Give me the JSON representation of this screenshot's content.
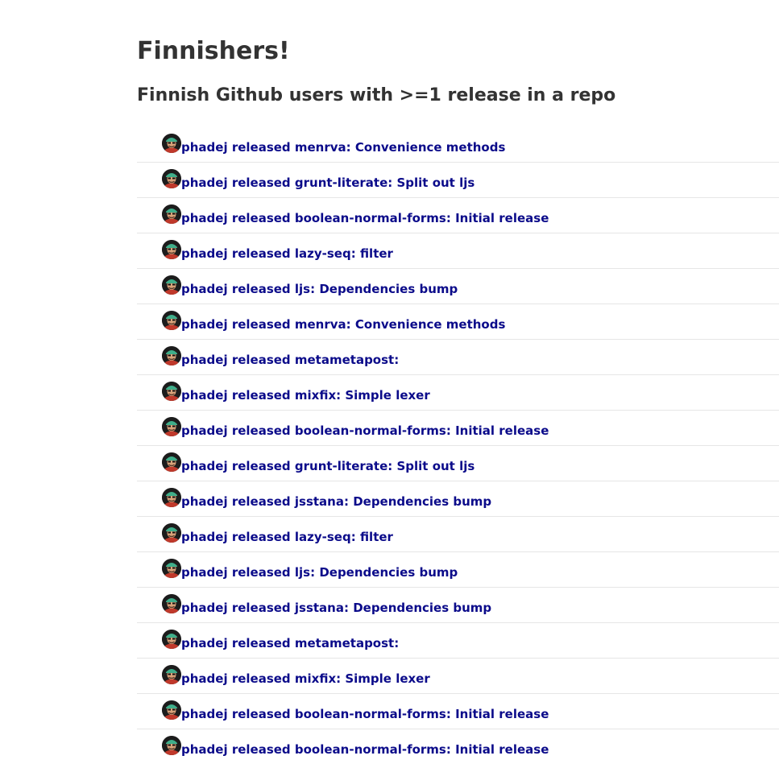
{
  "page": {
    "title": "Finnishers!",
    "subtitle": "Finnish Github users with >=1 release in a repo"
  },
  "colors": {
    "link": "#0b0b8a",
    "heading": "#333333",
    "divider": "#e6e6e6"
  },
  "feed": [
    {
      "avatar_icon": "user-avatar-icon",
      "text": "phadej released menrva: Convenience methods"
    },
    {
      "avatar_icon": "user-avatar-icon",
      "text": "phadej released grunt-literate: Split out ljs"
    },
    {
      "avatar_icon": "user-avatar-icon",
      "text": "phadej released boolean-normal-forms: Initial release"
    },
    {
      "avatar_icon": "user-avatar-icon",
      "text": "phadej released lazy-seq: filter"
    },
    {
      "avatar_icon": "user-avatar-icon",
      "text": "phadej released ljs: Dependencies bump"
    },
    {
      "avatar_icon": "user-avatar-icon",
      "text": "phadej released menrva: Convenience methods"
    },
    {
      "avatar_icon": "user-avatar-icon",
      "text": "phadej released metametapost:"
    },
    {
      "avatar_icon": "user-avatar-icon",
      "text": "phadej released mixfix: Simple lexer"
    },
    {
      "avatar_icon": "user-avatar-icon",
      "text": "phadej released boolean-normal-forms: Initial release"
    },
    {
      "avatar_icon": "user-avatar-icon",
      "text": "phadej released grunt-literate: Split out ljs"
    },
    {
      "avatar_icon": "user-avatar-icon",
      "text": "phadej released jsstana: Dependencies bump"
    },
    {
      "avatar_icon": "user-avatar-icon",
      "text": "phadej released lazy-seq: filter"
    },
    {
      "avatar_icon": "user-avatar-icon",
      "text": "phadej released ljs: Dependencies bump"
    },
    {
      "avatar_icon": "user-avatar-icon",
      "text": "phadej released jsstana: Dependencies bump"
    },
    {
      "avatar_icon": "user-avatar-icon",
      "text": "phadej released metametapost:"
    },
    {
      "avatar_icon": "user-avatar-icon",
      "text": "phadej released mixfix: Simple lexer"
    },
    {
      "avatar_icon": "user-avatar-icon",
      "text": "phadej released boolean-normal-forms: Initial release"
    },
    {
      "avatar_icon": "user-avatar-icon",
      "text": "phadej released boolean-normal-forms: Initial release"
    }
  ]
}
